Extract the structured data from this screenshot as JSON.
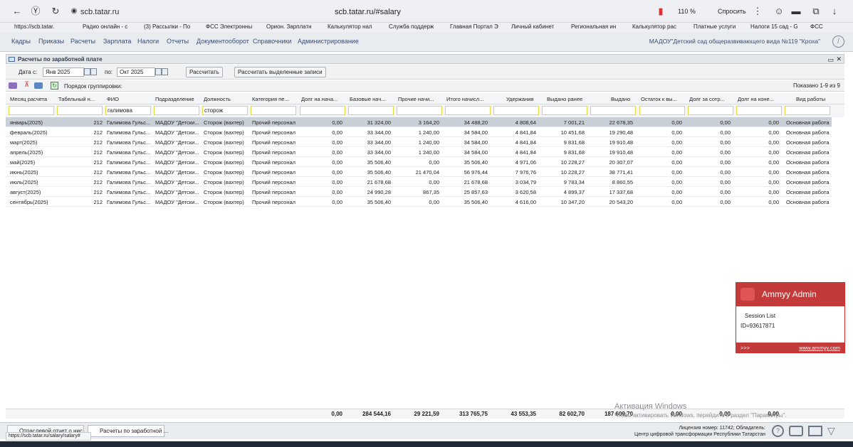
{
  "browser": {
    "site": "scb.tatar.ru",
    "url": "scb.tatar.ru/#salary",
    "zoom": "110 %",
    "ask": "Спросить"
  },
  "bookmarks": [
    "https://scb.tatar.",
    "Радио онлайн - с",
    "(3) Рассылки - По",
    "ФСС Электронны",
    "Орион. Зарплатн",
    "Калькулятор нал",
    "Служба поддерж",
    "Главная Портал Э",
    "Личный кабинет",
    "Региональная ин",
    "Калькулятор рас",
    "Платные услуги",
    "Налоги 15 сад - G",
    "ФСС"
  ],
  "appnav": {
    "items": [
      "Кадры",
      "Приказы",
      "Расчеты",
      "Зарплата",
      "Налоги",
      "Отчеты",
      "Документооборот",
      "Справочники",
      "Администрирование"
    ],
    "org": "МАДОУ\"Детский сад общеразвивающего вида №119 \"Кроха\""
  },
  "panel": {
    "title": "Расчеты по заработной плате"
  },
  "toolbar": {
    "date_from_label": "Дата с:",
    "date_from": "Янв 2025",
    "date_to_label": "по:",
    "date_to": "Окт 2025",
    "calc": "Рассчитать",
    "calc_sel": "Рассчитать выделенные записи"
  },
  "grid": {
    "group_label": "Порядок группировки:",
    "shown": "Показано 1-9 из 9",
    "headers": [
      "Месяц расчета",
      "Табельный н...",
      "ФИО",
      "Подразделение",
      "Должность",
      "Категория пе...",
      "Долг на нача...",
      "Базовые нач...",
      "Прочие начи...",
      "Итого начисл...",
      "Удержания",
      "Выдано ранее",
      "Выдано",
      "Остаток к вы...",
      "Долг за сотр...",
      "Долг на коне...",
      "Вид работы"
    ],
    "filters": {
      "fio": "галимова",
      "position": "сторож"
    },
    "rows": [
      [
        "январь(2025)",
        "212",
        "Галимова Гульс...",
        "МАДОУ \"Детски...",
        "Сторож (вахтер)",
        "Прочий персонал",
        "0,00",
        "31 324,00",
        "3 164,20",
        "34 488,20",
        "4 808,64",
        "7 001,21",
        "22 678,35",
        "0,00",
        "0,00",
        "0,00",
        "Основная работа"
      ],
      [
        "февраль(2025)",
        "212",
        "Галимова Гульс...",
        "МАДОУ \"Детски...",
        "Сторож (вахтер)",
        "Прочий персонал",
        "0,00",
        "33 344,00",
        "1 240,00",
        "34 584,00",
        "4 841,84",
        "10 451,68",
        "19 290,48",
        "0,00",
        "0,00",
        "0,00",
        "Основная работа"
      ],
      [
        "март(2025)",
        "212",
        "Галимова Гульс...",
        "МАДОУ \"Детски...",
        "Сторож (вахтер)",
        "Прочий персонал",
        "0,00",
        "33 344,00",
        "1 240,00",
        "34 584,00",
        "4 841,84",
        "9 831,68",
        "19 910,48",
        "0,00",
        "0,00",
        "0,00",
        "Основная работа"
      ],
      [
        "апрель(2025)",
        "212",
        "Галимова Гульс...",
        "МАДОУ \"Детски...",
        "Сторож (вахтер)",
        "Прочий персонал",
        "0,00",
        "33 344,00",
        "1 240,00",
        "34 584,00",
        "4 841,84",
        "9 831,68",
        "19 910,48",
        "0,00",
        "0,00",
        "0,00",
        "Основная работа"
      ],
      [
        "май(2025)",
        "212",
        "Галимова Гульс...",
        "МАДОУ \"Детски...",
        "Сторож (вахтер)",
        "Прочий персонал",
        "0,00",
        "35 506,40",
        "0,00",
        "35 506,40",
        "4 971,06",
        "10 228,27",
        "20 307,07",
        "0,00",
        "0,00",
        "0,00",
        "Основная работа"
      ],
      [
        "июнь(2025)",
        "212",
        "Галимова Гульс...",
        "МАДОУ \"Детски...",
        "Сторож (вахтер)",
        "Прочий персонал",
        "0,00",
        "35 506,40",
        "21 470,04",
        "56 976,44",
        "7 976,76",
        "10 228,27",
        "38 771,41",
        "0,00",
        "0,00",
        "0,00",
        "Основная работа"
      ],
      [
        "июль(2025)",
        "212",
        "Галимова Гульс...",
        "МАДОУ \"Детски...",
        "Сторож (вахтер)",
        "Прочий персонал",
        "0,00",
        "21 678,68",
        "0,00",
        "21 678,68",
        "3 034,79",
        "9 783,34",
        "8 860,55",
        "0,00",
        "0,00",
        "0,00",
        "Основная работа"
      ],
      [
        "август(2025)",
        "212",
        "Галимова Гульс...",
        "МАДОУ \"Детски...",
        "Сторож (вахтер)",
        "Прочий персонал",
        "0,00",
        "24 990,28",
        "867,35",
        "25 857,63",
        "3 620,58",
        "4 899,37",
        "17 337,68",
        "0,00",
        "0,00",
        "0,00",
        "Основная работа"
      ],
      [
        "сентябрь(2025)",
        "212",
        "Галимова Гульс...",
        "МАДОУ \"Детски...",
        "Сторож (вахтер)",
        "Прочий персонал",
        "0,00",
        "35 506,40",
        "0,00",
        "35 506,40",
        "4 616,00",
        "10 347,20",
        "20 543,20",
        "0,00",
        "0,00",
        "0,00",
        "Основная работа"
      ]
    ],
    "totals": [
      "0,00",
      "284 544,16",
      "29 221,59",
      "313 765,75",
      "43 553,35",
      "82 602,70",
      "187 609,70",
      "0,00",
      "0,00",
      "0,00"
    ]
  },
  "ammyy": {
    "title": "Ammyy Admin",
    "session": "Session List",
    "id": "ID=93617871",
    "more": ">>>",
    "link": "www.ammyy.com"
  },
  "windows": {
    "title": "Активация Windows",
    "sub": "Чтобы активировать Windows, перейдите в раздел \"Параметры\"."
  },
  "bottom": {
    "tab1": "Отраслевой отчет о нис...",
    "tab2": "Расчеты по заработной ...",
    "license": "Лицензия номер: 11742; Обладатель:",
    "center": "Центр цифровой трансформации Республики Татарстан",
    "status_url": "https://scb.tatar.ru/salary/salary#"
  }
}
